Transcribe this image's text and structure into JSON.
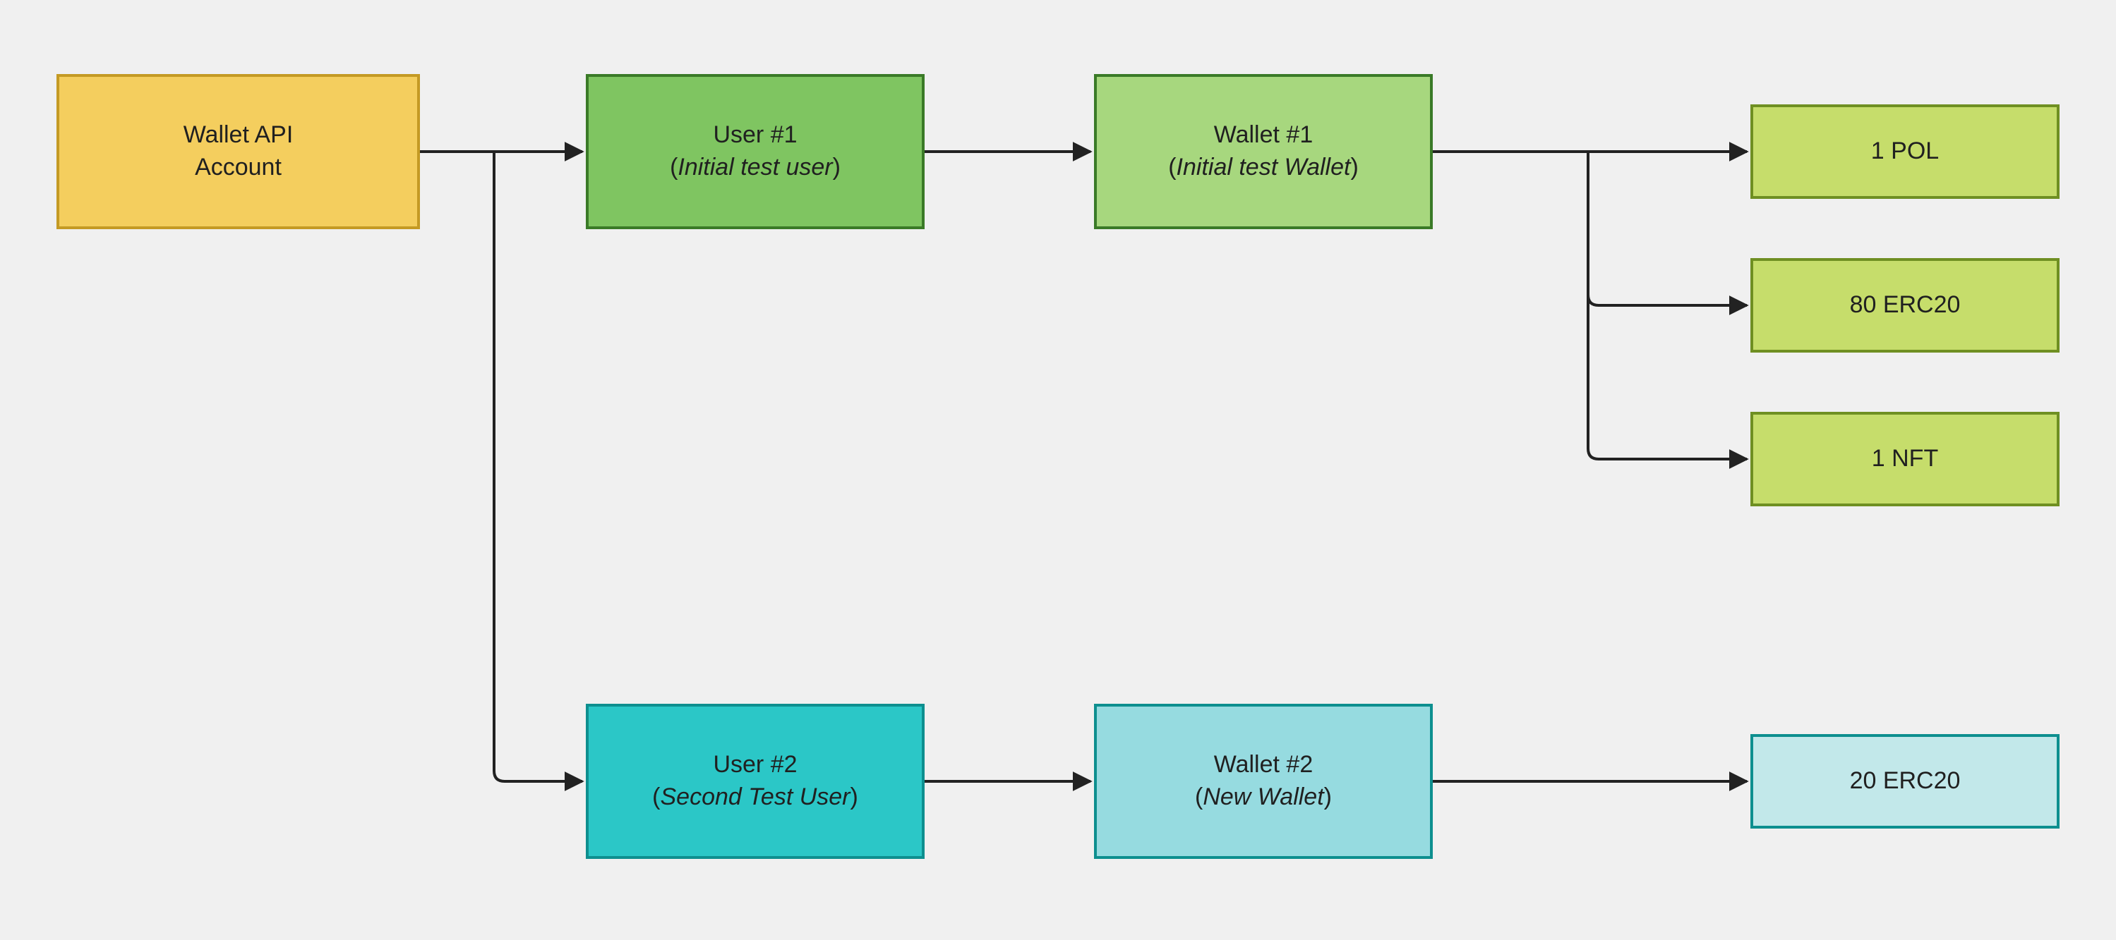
{
  "nodes": {
    "account": {
      "title": "Wallet API",
      "line2": "Account"
    },
    "user1": {
      "title": "User #1",
      "sub": "Initial test user"
    },
    "wallet1": {
      "title": "Wallet #1",
      "sub": "Initial test Wallet"
    },
    "asset_pol": {
      "title": "1 POL"
    },
    "asset_erc20": {
      "title": "80 ERC20"
    },
    "asset_nft": {
      "title": "1 NFT"
    },
    "user2": {
      "title": "User #2",
      "sub": "Second Test User"
    },
    "wallet2": {
      "title": "Wallet #2",
      "sub": "New Wallet"
    },
    "asset_erc20_b": {
      "title": "20 ERC20"
    }
  }
}
